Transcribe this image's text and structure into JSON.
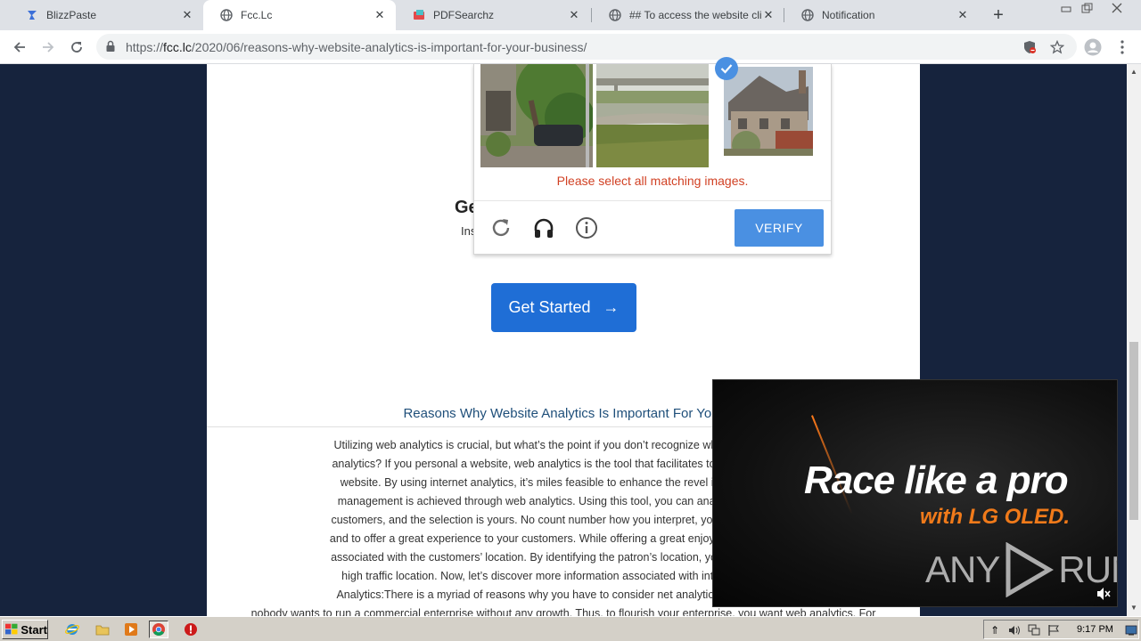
{
  "tabs": [
    {
      "title": "BlizzPaste",
      "active": false
    },
    {
      "title": "Fcc.Lc",
      "active": true
    },
    {
      "title": "PDFSearchz",
      "active": false
    },
    {
      "title": "## To access the website click t",
      "active": false
    },
    {
      "title": "Notification",
      "active": false
    }
  ],
  "address": {
    "scheme": "https://",
    "host": "fcc.lc",
    "path": "/2020/06/reasons-why-website-analytics-is-important-for-your-business/"
  },
  "hero": {
    "heading": "Ge",
    "sub": "Ins",
    "button_label": "Get Started",
    "button_arrow": "→"
  },
  "captcha": {
    "error_message": "Please select all matching images.",
    "verify_label": "VERIFY"
  },
  "article": {
    "title": "Reasons Why Website Analytics Is Important For Your",
    "lines": [
      "Utilizing web analytics is crucial, but what’s the point if you don’t recognize what Web analytic",
      "analytics? If you personal a website, web analytics is the tool that facilitates to find how your tr",
      "website. By using internet analytics, it’s miles feasible to enhance the revel in of traffic. In c",
      "management is achieved through web analytics. Using this tool, you can analyze a selected",
      "customers, and the selection is yours. No count number how you interpret, you can collect info",
      "and to offer a great experience to your customers. While offering a great enjoy to your custome",
      "associated with the customers’ location. By identifying the patron’s location, you may be capab",
      "high traffic location. Now, let’s discover more information associated with internet analytics",
      "Analytics:There is a myriad of reasons why you have to consider net analytics, however let’s",
      "nobody wants to run a commercial enterprise without any growth. Thus, to flourish your enterprise, you want web analytics. For"
    ]
  },
  "video": {
    "line1": "Race like a pro",
    "line2": "with LG OLED.",
    "watermark_left": "ANY",
    "watermark_right": "RUN"
  },
  "taskbar": {
    "start_label": "Start",
    "clock": "9:17 PM"
  },
  "colors": {
    "accent_blue": "#1f6ed6",
    "verify_blue": "#4a90e2",
    "error_red": "#d14124",
    "title_blue": "#1f4f7a",
    "video_orange": "#f07a1a",
    "page_background": "#16233d"
  }
}
